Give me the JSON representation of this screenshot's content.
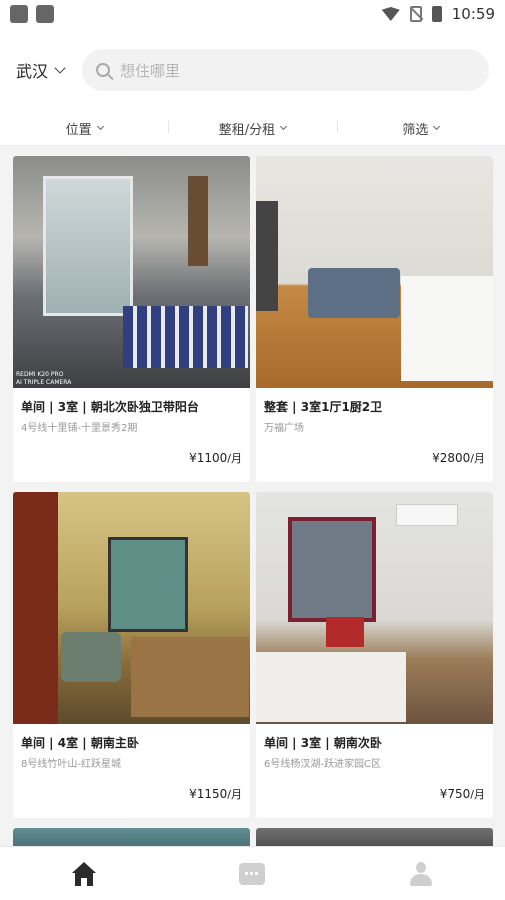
{
  "status": {
    "time": "10:59"
  },
  "header": {
    "city": "武汉",
    "search_placeholder": "想住哪里"
  },
  "filters": [
    {
      "label": "位置"
    },
    {
      "label": "整租/分租"
    },
    {
      "label": "筛选"
    }
  ],
  "listings": [
    {
      "title": "单间 | 3室 | 朝北次卧独卫带阳台",
      "location": "4号线十里铺-十里景秀2期",
      "price": "¥1100",
      "unit": "/月",
      "watermark": "REDMI K20 PRO\nAI TRIPLE CAMERA"
    },
    {
      "title": "整套 | 3室1厅1厨2卫",
      "location": "万福广场",
      "price": "¥2800",
      "unit": "/月"
    },
    {
      "title": "单间 | 4室 | 朝南主卧",
      "location": "8号线竹叶山-红跃星城",
      "price": "¥1150",
      "unit": "/月"
    },
    {
      "title": "单间 | 3室 | 朝南次卧",
      "location": "6号线杨汊湖-跃进家园C区",
      "price": "¥750",
      "unit": "/月"
    }
  ],
  "tabbar": {
    "items": [
      "home",
      "messages",
      "profile"
    ]
  }
}
